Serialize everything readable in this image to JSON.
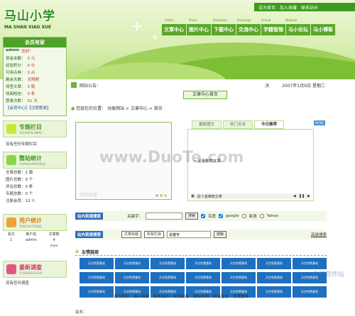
{
  "header": {
    "logo_zh": "马山小学",
    "logo_en": "MA SHAN XIAO XUE",
    "top_links": [
      "设为首页",
      "加入收藏",
      "联系站长"
    ],
    "nav_sub": [
      "Article",
      "Photo",
      "Download",
      "Exchange",
      "School",
      "Network"
    ],
    "nav": [
      "文章中心",
      "图片中心",
      "下载中心",
      "交流中心",
      "学籍管理",
      "马小论坛",
      "马小博客"
    ]
  },
  "login": {
    "title": "会员有家",
    "user": "admin",
    "greeting": "您好！",
    "rows": [
      {
        "k": "资金余额：",
        "v": "0 元"
      },
      {
        "k": "经验积分：",
        "v": "0 分"
      },
      {
        "k": "可用点券：",
        "v": "0 点"
      },
      {
        "k": "剩余天数：",
        "v": "无限期"
      },
      {
        "k": "待签文章：",
        "v": "0 篇"
      },
      {
        "k": "待阅短信：",
        "v": "0 条"
      },
      {
        "k": "登录次数：",
        "v": "51 次"
      }
    ],
    "links": "【会员中心】【注销登录】"
  },
  "topics": {
    "title": "专题栏目",
    "subtitle": "ZHUANTILANMU",
    "empty": "没有任何专题栏目"
  },
  "stats": {
    "title": "整站统计",
    "subtitle": "ZHANZHANTONGJI",
    "rows": [
      "文章总数：2 篇",
      "图片总数：0 个",
      "评论总数：0 条",
      "专题总数：0 个",
      "注册会员：12 人"
    ]
  },
  "users": {
    "title": "用户统计",
    "subtitle": "YONGHUTONGJI",
    "headers": [
      "名次",
      "用户名",
      "文章数"
    ],
    "row": [
      "1",
      "admin",
      "4"
    ],
    "more": "more"
  },
  "survey": {
    "title": "最新调查",
    "subtitle": "ZUIXINDIAOCHA",
    "empty": "没有任何调查"
  },
  "notice": {
    "label": "网站公告：",
    "right": "决",
    "date": "2007年1月9日 星期二"
  },
  "home_button": "文章中心首页",
  "breadcrumb": {
    "prefix": "您现在的位置：",
    "path": "动易网站 > 文章中心 > 首页"
  },
  "slideshow": {
    "caption": "网站标签"
  },
  "tabs": [
    {
      "label": "最新图文",
      "active": false
    },
    {
      "label": "热门点击",
      "active": false
    },
    {
      "label": "今日推荐",
      "active": true
    }
  ],
  "more_tag": "MORE",
  "tabpanel": {
    "item": "没有推荐文章",
    "footer": "前十首推荐文章"
  },
  "search1": {
    "label": "站内资源搜索",
    "kw_label": "关键字：",
    "btn": "搜索",
    "opts": [
      "百度",
      "google",
      "新浪",
      "Yahoo"
    ]
  },
  "search2": {
    "label": "站内资源搜索",
    "select1": "文章标题",
    "select2": "所有栏目",
    "kw": "关键字",
    "btn": "搜索",
    "advanced": "高级搜索"
  },
  "links": {
    "title": "友情链接",
    "items": [
      "天空免费基地",
      "天空免费基地",
      "天空免费基地",
      "天空免费基地",
      "天空免费基地",
      "天空免费基地",
      "天空免费基地",
      "天空免费基地",
      "天空免费基地",
      "天空免费基地",
      "天空免费基地",
      "天空免费基地",
      "天空免费基地",
      "天空免费基地",
      "天空免费基地",
      "天空免费基地",
      "天空免费基地",
      "天空免费基地",
      "天空免费基地",
      "天空免费基地",
      "天空免费基地"
    ]
  },
  "footer": [
    "设为首页",
    "加入收藏",
    "联系站长",
    "友情链接",
    "版权申明",
    "网站留言",
    "管理登录"
  ],
  "bottom": {
    "label": "站长："
  },
  "watermark": {
    "text": "www.DuoTe.com",
    "brand": "多特软件站"
  }
}
